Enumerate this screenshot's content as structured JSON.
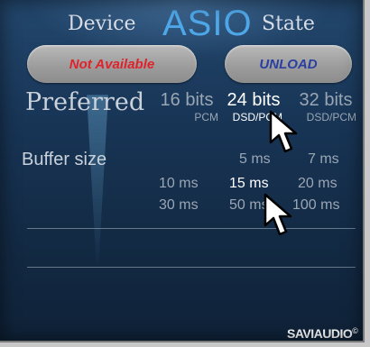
{
  "header": {
    "device": "Device",
    "asio": "ASIO",
    "state": "State"
  },
  "buttons": {
    "not_available": "Not Available",
    "unload": "UNLOAD"
  },
  "preferred": {
    "label": "Preferred",
    "options": [
      {
        "bits": "16 bits",
        "format": "PCM",
        "selected": false
      },
      {
        "bits": "24 bits",
        "format": "DSD/PCM",
        "selected": true
      },
      {
        "bits": "32 bits",
        "format": "DSD/PCM",
        "selected": false
      }
    ]
  },
  "buffer": {
    "label": "Buffer size",
    "options": [
      "5 ms",
      "7 ms",
      "10 ms",
      "15 ms",
      "20 ms",
      "30 ms",
      "50 ms",
      "100 ms"
    ],
    "selected": "15 ms"
  },
  "logo": {
    "text": "SAVIAUDIO",
    "mark": "©"
  },
  "colors": {
    "accent": "#4ea7e8",
    "not_available": "#e0232b",
    "unload": "#2a3fa0",
    "selected_text": "#ffffff",
    "inactive_text": "#9aa6b4"
  }
}
